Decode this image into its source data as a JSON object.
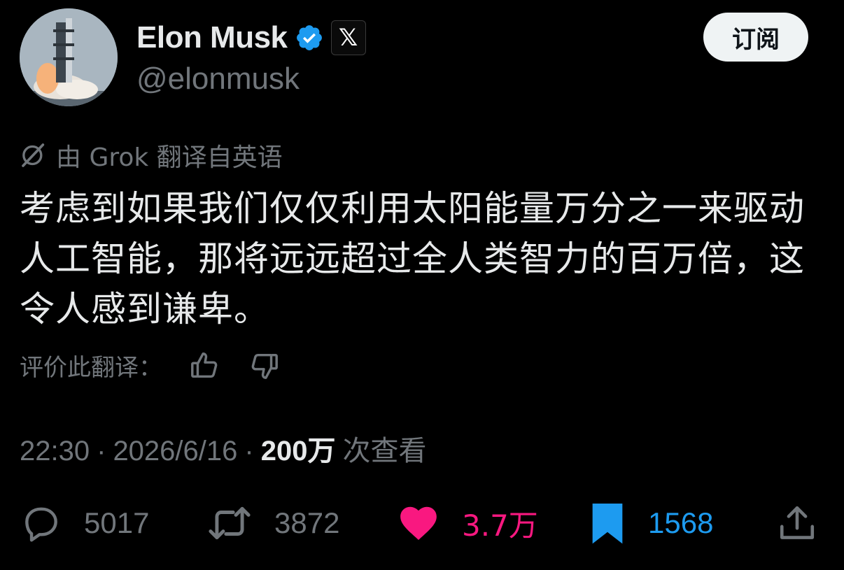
{
  "header": {
    "name": "Elon Musk",
    "handle": "@elonmusk",
    "subscribe_label": "订阅",
    "badge_x": "𝕏"
  },
  "translation": {
    "label": "由 Grok 翻译自英语"
  },
  "tweet": {
    "text": "考虑到如果我们仅仅利用太阳能量万分之一来驱动人工智能，那将远远超过全人类智力的百万倍，这令人感到谦卑。"
  },
  "rating": {
    "label": "评价此翻译："
  },
  "meta": {
    "time": "22:30",
    "sep1": "·",
    "date": "2026/6/16",
    "sep2": "·",
    "views": "200万",
    "views_label": "次查看"
  },
  "actions": {
    "replies": "5017",
    "retweets": "3872",
    "likes": "3.7万",
    "bookmarks": "1568"
  },
  "colors": {
    "background": "#000000",
    "text": "#e7e9ea",
    "muted": "#71767b",
    "like": "#f91880",
    "bookmark": "#1d9bf0",
    "verified": "#1d9bf0"
  },
  "icons": {
    "verified": "verified-badge-icon",
    "grok": "grok-icon",
    "thumb_up": "thumbs-up-icon",
    "thumb_down": "thumbs-down-icon",
    "reply": "reply-icon",
    "retweet": "retweet-icon",
    "like": "heart-icon",
    "bookmark": "bookmark-icon",
    "share": "share-icon"
  }
}
